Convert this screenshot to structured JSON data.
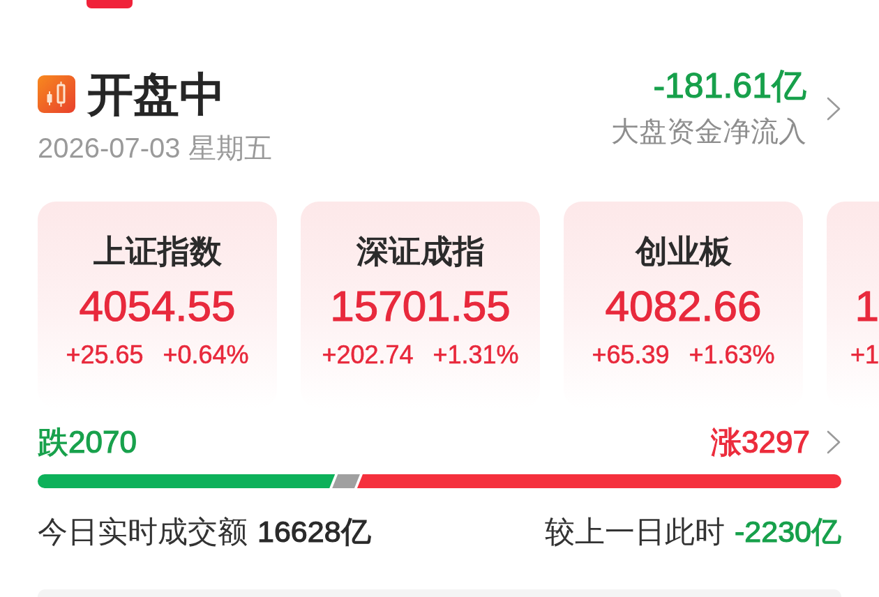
{
  "status": {
    "title": "开盘中",
    "date": "2026-07-03 星期五"
  },
  "net_inflow": {
    "value": "-181.61亿",
    "label": "大盘资金净流入",
    "rising": false
  },
  "indices": [
    {
      "name": "上证指数",
      "value": "4054.55",
      "change": "+25.65",
      "change_pct": "+0.64%",
      "rising": true
    },
    {
      "name": "深证成指",
      "value": "15701.55",
      "change": "+202.74",
      "change_pct": "+1.31%",
      "rising": true
    },
    {
      "name": "创业板",
      "value": "4082.66",
      "change": "+65.39",
      "change_pct": "+1.63%",
      "rising": true
    }
  ],
  "cut_index": {
    "value": "1",
    "change": "+1",
    "rising": true
  },
  "breadth": {
    "fall": "跌2070",
    "rise": "涨3297",
    "decline_bar": {
      "level": 0.37
    },
    "advance_bar": {
      "level": 0.599
    }
  },
  "turnover": {
    "label": "今日实时成交额",
    "value": "16628亿",
    "compare_label": "较上一日此时",
    "compare_value": "-2230亿",
    "compare_rising": false
  }
}
